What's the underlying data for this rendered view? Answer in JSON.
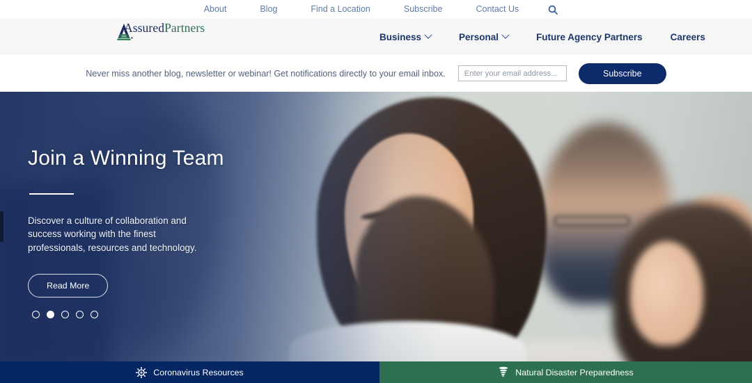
{
  "utility_nav": {
    "items": [
      {
        "label": "About",
        "name": "utility-link-about"
      },
      {
        "label": "Blog",
        "name": "utility-link-blog"
      },
      {
        "label": "Find a Location",
        "name": "utility-link-find-a-location"
      },
      {
        "label": "Subscribe",
        "name": "utility-link-subscribe"
      },
      {
        "label": "Contact Us",
        "name": "utility-link-contact-us"
      }
    ],
    "search_icon": "search-icon"
  },
  "brand": {
    "word_part_1": "Assured",
    "word_part_2": "Partners",
    "mark_icon": "assuredpartners-a-mark-icon",
    "navy": "#1b2a5e",
    "green": "#2d6e4e"
  },
  "main_nav": {
    "items": [
      {
        "label": "Business",
        "has_dropdown": true
      },
      {
        "label": "Personal",
        "has_dropdown": true
      },
      {
        "label": "Future Agency Partners",
        "has_dropdown": false
      },
      {
        "label": "Careers",
        "has_dropdown": false
      }
    ]
  },
  "subscribe_bar": {
    "message": "Never miss another blog, newsletter or webinar! Get notifications directly to your email inbox.",
    "email_value": "",
    "email_placeholder": "Enter your email address...",
    "button_label": "Subscribe",
    "button_color": "#0d2a6b"
  },
  "hero": {
    "title": "Join a Winning Team",
    "body": "Discover a culture of collaboration and success working with the finest professionals, resources and technology.",
    "cta_label": "Read More",
    "slide_count": 5,
    "active_slide": 2,
    "overlay_color": "#1b2e5e"
  },
  "banners": [
    {
      "label": "Coronavirus Resources",
      "icon": "virus-icon",
      "color": "#042663"
    },
    {
      "label": "Natural Disaster Preparedness",
      "icon": "tornado-icon",
      "color": "#2d7050"
    }
  ]
}
